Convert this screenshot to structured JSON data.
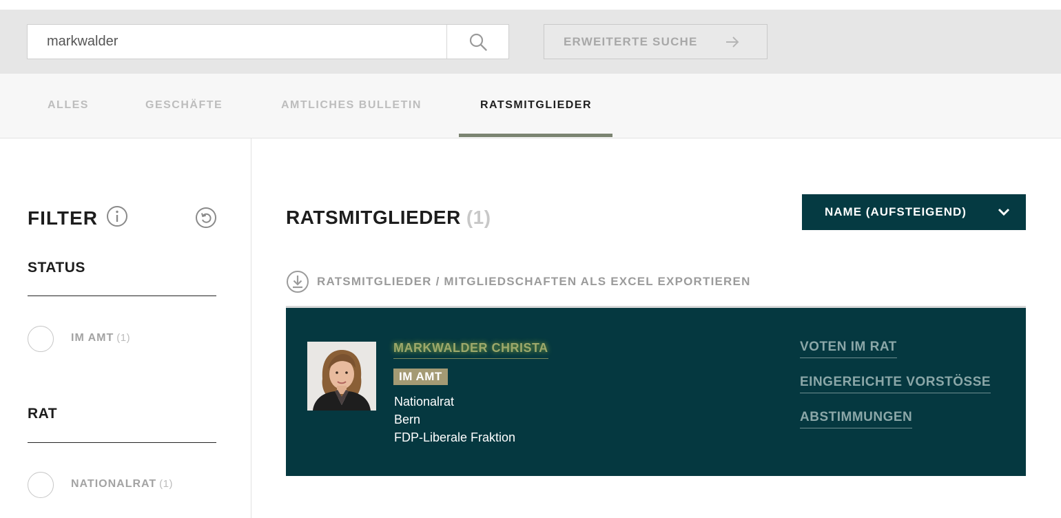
{
  "search": {
    "value": "markwalder",
    "advanced_label": "ERWEITERTE SUCHE"
  },
  "tabs": [
    {
      "label": "ALLES",
      "active": false
    },
    {
      "label": "GESCHÄFTE",
      "active": false
    },
    {
      "label": "AMTLICHES BULLETIN",
      "active": false
    },
    {
      "label": "RATSMITGLIEDER",
      "active": true
    }
  ],
  "filter": {
    "title": "FILTER",
    "sections": [
      {
        "title": "STATUS",
        "options": [
          {
            "label": "IM AMT",
            "count": "(1)"
          }
        ]
      },
      {
        "title": "RAT",
        "options": [
          {
            "label": "NATIONALRAT",
            "count": "(1)"
          }
        ]
      }
    ]
  },
  "results": {
    "title": "RATSMITGLIEDER",
    "count": "(1)",
    "sort_label": "NAME (AUFSTEIGEND)",
    "export_label": "RATSMITGLIEDER / MITGLIEDSCHAFTEN ALS EXCEL EXPORTIEREN",
    "members": [
      {
        "name": "MARKWALDER CHRISTA",
        "status": "IM AMT",
        "council": "Nationalrat",
        "canton": "Bern",
        "faction": "FDP-Liberale Fraktion",
        "links": [
          "VOTEN IM RAT",
          "EINGEREICHTE VORSTÖSSE",
          "ABSTIMMUNGEN"
        ]
      }
    ]
  },
  "colors": {
    "card_bg": "#053840",
    "sort_bg": "#053a42",
    "badge_bg": "#a49a74",
    "tab_underline": "#7b8471",
    "name_highlight": "#9da86b"
  }
}
